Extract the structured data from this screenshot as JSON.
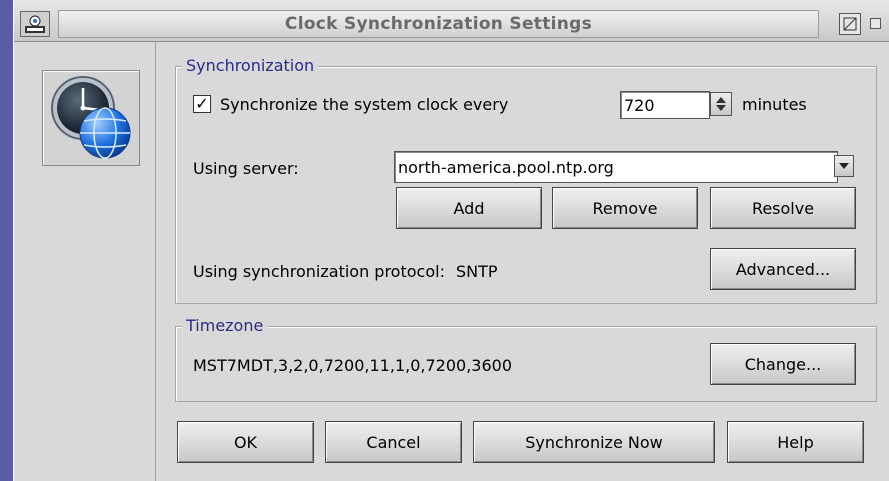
{
  "window": {
    "title": "Clock Synchronization Settings"
  },
  "synchronization": {
    "group_label": "Synchronization",
    "checkbox_checked": true,
    "checkbox_mark": "✓",
    "checkbox_label": "Synchronize the system clock every",
    "interval_value": "720",
    "interval_unit": "minutes",
    "server_label": "Using server:",
    "server_value": "north-america.pool.ntp.org",
    "add_button": "Add",
    "remove_button": "Remove",
    "resolve_button": "Resolve",
    "protocol_label": "Using synchronization protocol:",
    "protocol_value": "SNTP",
    "advanced_button": "Advanced..."
  },
  "timezone": {
    "group_label": "Timezone",
    "value": "MST7MDT,3,2,0,7200,11,1,0,7200,3600",
    "change_button": "Change..."
  },
  "footer": {
    "ok_button": "OK",
    "cancel_button": "Cancel",
    "sync_now_button": "Synchronize Now",
    "help_button": "Help"
  },
  "icons": {
    "system_menu": "system-menu-icon",
    "maximize": "maximize-icon",
    "minimize": "minimize-icon",
    "clock_globe": "clock-globe-icon",
    "spin": "spin-arrows-icon",
    "dropdown": "chevron-down-icon"
  },
  "colors": {
    "desktop": "#5a5da3",
    "window_bg": "#d9d9d9",
    "group_label": "#2a2a8a"
  }
}
